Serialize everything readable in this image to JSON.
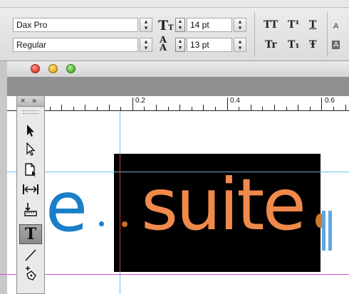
{
  "controls": {
    "font_family": "Dax Pro",
    "font_style": "Regular",
    "font_size": "14 pt",
    "leading": "13 pt",
    "style_buttons_row1": [
      "TT",
      "T¹",
      "T"
    ],
    "style_buttons_row2": [
      "Tr",
      "T₁",
      "Ŧ"
    ],
    "overflow_letter": "A"
  },
  "ruler": {
    "labels": [
      "0.2",
      "0.4",
      "0.6"
    ]
  },
  "tools_panel": {
    "close_glyph": "×",
    "collapse_glyph": "»"
  },
  "canvas": {
    "text_left": "e",
    "text_main": "suite"
  },
  "colors": {
    "window_red": "#e8443a",
    "window_yellow": "#e8b02a",
    "window_green": "#5cbb3c",
    "blue_text": "#1a7fc8",
    "orange_text": "#f08a4b",
    "frame_fill": "#000000",
    "guide_cyan": "#5ec8f0",
    "guide_magenta": "#d050d0"
  }
}
